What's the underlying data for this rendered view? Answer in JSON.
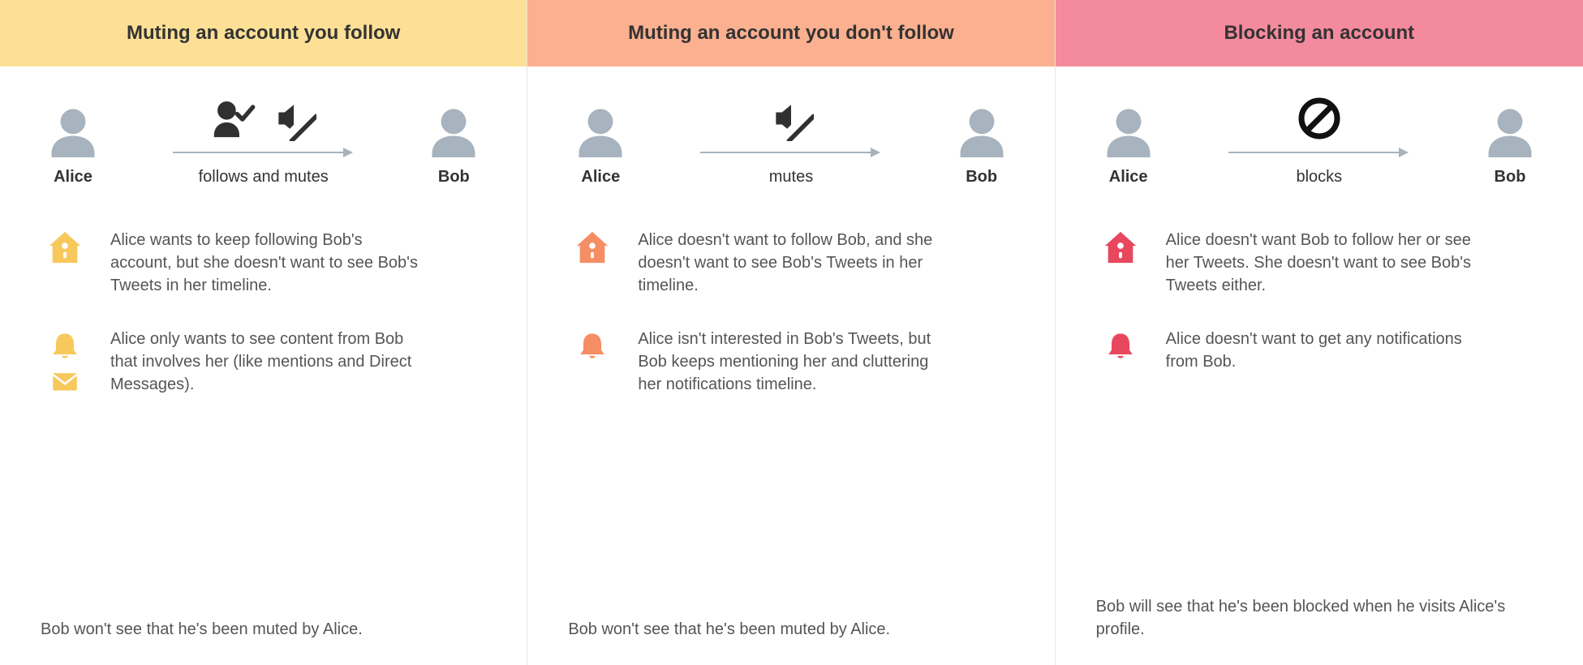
{
  "columns": [
    {
      "header": "Muting an account you follow",
      "left_name": "Alice",
      "right_name": "Bob",
      "action": "follows and mutes",
      "bullets": [
        {
          "text": "Alice wants to keep following Bob's account, but she doesn't want to see Bob's Tweets in her timeline."
        },
        {
          "text": "Alice only wants to see content from Bob that involves her (like mentions and Direct Messages)."
        }
      ],
      "footer": "Bob won't see that he's been muted by Alice."
    },
    {
      "header": "Muting an account you don't follow",
      "left_name": "Alice",
      "right_name": "Bob",
      "action": "mutes",
      "bullets": [
        {
          "text": "Alice doesn't want to follow Bob, and she doesn't want to see Bob's Tweets in her timeline."
        },
        {
          "text": "Alice isn't interested in Bob's Tweets, but Bob keeps mentioning her and cluttering her notifications timeline."
        }
      ],
      "footer": "Bob won't see that he's been muted by Alice."
    },
    {
      "header": "Blocking an account",
      "left_name": "Alice",
      "right_name": "Bob",
      "action": "blocks",
      "bullets": [
        {
          "text": "Alice doesn't want Bob to follow her or see her Tweets. She doesn't want to see Bob's Tweets either."
        },
        {
          "text": "Alice doesn't want to get any notifications from Bob."
        }
      ],
      "footer": "Bob will see that he's been blocked when he visits Alice's profile."
    }
  ],
  "colors": {
    "yellow": "#f7c95c",
    "orange": "#f58e64",
    "red": "#e8485e",
    "headers": [
      "#fde095",
      "#fbb08f",
      "#f48a9d"
    ]
  }
}
